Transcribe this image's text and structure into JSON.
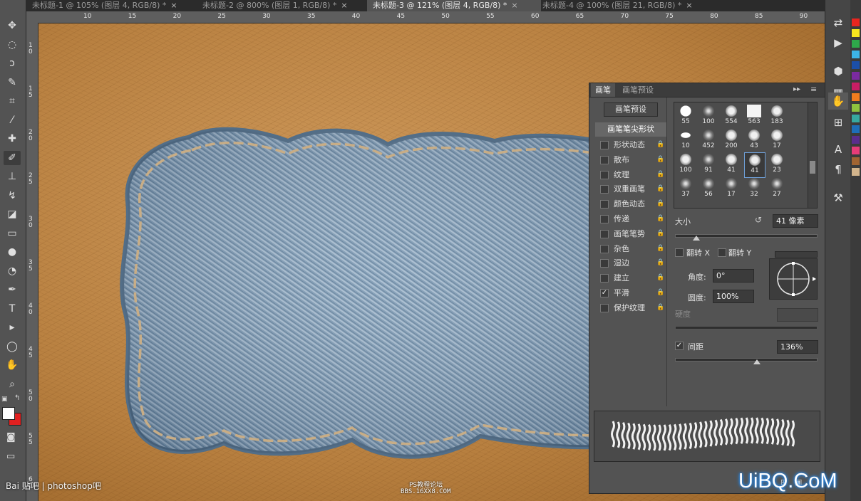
{
  "tabs": [
    {
      "label": "未标题-1 @ 105% (图层 4, RGB/8) *",
      "active": false
    },
    {
      "label": "未标题-2 @ 800% (图层 1, RGB/8) *",
      "active": false
    },
    {
      "label": "未标题-3 @ 121% (图层 4, RGB/8) *",
      "active": true
    },
    {
      "label": "未标题-4 @ 100% (图层 21, RGB/8) *",
      "active": false
    }
  ],
  "tab_close": "×",
  "ruler_h": [
    "10",
    "15",
    "20",
    "25",
    "30",
    "35",
    "40",
    "45",
    "50",
    "55",
    "60",
    "65",
    "70",
    "75",
    "80",
    "85",
    "90"
  ],
  "ruler_v": [
    "10",
    "15",
    "20",
    "25",
    "30",
    "35",
    "40",
    "45",
    "50",
    "55",
    "60"
  ],
  "tools": [
    {
      "name": "move-tool-icon",
      "glyph": "✥"
    },
    {
      "name": "marquee-tool-icon",
      "glyph": "◌"
    },
    {
      "name": "lasso-tool-icon",
      "glyph": "ↄ"
    },
    {
      "name": "quick-select-tool-icon",
      "glyph": "✎"
    },
    {
      "name": "crop-tool-icon",
      "glyph": "⌗"
    },
    {
      "name": "eyedropper-tool-icon",
      "glyph": "⁄"
    },
    {
      "name": "healing-brush-tool-icon",
      "glyph": "✚"
    },
    {
      "name": "brush-tool-icon",
      "glyph": "✐"
    },
    {
      "name": "clone-stamp-tool-icon",
      "glyph": "⊥"
    },
    {
      "name": "history-brush-tool-icon",
      "glyph": "↯"
    },
    {
      "name": "eraser-tool-icon",
      "glyph": "◪"
    },
    {
      "name": "gradient-tool-icon",
      "glyph": "▭"
    },
    {
      "name": "blur-tool-icon",
      "glyph": "●"
    },
    {
      "name": "dodge-tool-icon",
      "glyph": "◔"
    },
    {
      "name": "pen-tool-icon",
      "glyph": "✒"
    },
    {
      "name": "type-tool-icon",
      "glyph": "T"
    },
    {
      "name": "path-select-tool-icon",
      "glyph": "▸"
    },
    {
      "name": "ellipse-tool-icon",
      "glyph": "◯"
    },
    {
      "name": "hand-tool-icon",
      "glyph": "✋"
    },
    {
      "name": "zoom-tool-icon",
      "glyph": "⌕"
    }
  ],
  "colors": {
    "foreground": "#ffffff",
    "background": "#e02020",
    "accent": "#1f8fff"
  },
  "brush_panel": {
    "tab_brush": "画笔",
    "tab_presets": "画笔预设",
    "presets_button": "画笔预设",
    "tip_shape": "画笔笔尖形状",
    "options": [
      {
        "label": "形状动态",
        "checked": false
      },
      {
        "label": "散布",
        "checked": false
      },
      {
        "label": "纹理",
        "checked": false
      },
      {
        "label": "双重画笔",
        "checked": false
      },
      {
        "label": "颜色动态",
        "checked": false
      },
      {
        "label": "传递",
        "checked": false
      },
      {
        "label": "画笔笔势",
        "checked": false
      },
      {
        "label": "杂色",
        "checked": false
      },
      {
        "label": "湿边",
        "checked": false
      },
      {
        "label": "建立",
        "checked": false
      },
      {
        "label": "平滑",
        "checked": true
      },
      {
        "label": "保护纹理",
        "checked": false
      }
    ],
    "lock_icon": "🔒",
    "tips": [
      [
        "55",
        "100",
        "554",
        "563",
        "183"
      ],
      [
        "10",
        "452",
        "200",
        "43",
        "17"
      ],
      [
        "100",
        "91",
        "41",
        "41",
        "23"
      ],
      [
        "37",
        "56",
        "17",
        "32",
        "27"
      ]
    ],
    "selected_tip": "41",
    "size_label": "大小",
    "size_value": "41 像素",
    "flip_x": "翻转 X",
    "flip_y": "翻转 Y",
    "angle_label": "角度:",
    "angle_value": "0°",
    "roundness_label": "圆度:",
    "roundness_value": "100%",
    "hardness_label": "硬度",
    "spacing_label": "间距",
    "spacing_value": "136%",
    "spacing_checked": true,
    "size_slider": 0.15,
    "spacing_slider": 0.58
  },
  "watermarks": {
    "left": "Bai 贴吧 | photoshop吧",
    "center_top": "PS教程论坛",
    "center_bottom": "BBS.16XX8.COM",
    "right": "UiBQ.CoM"
  }
}
